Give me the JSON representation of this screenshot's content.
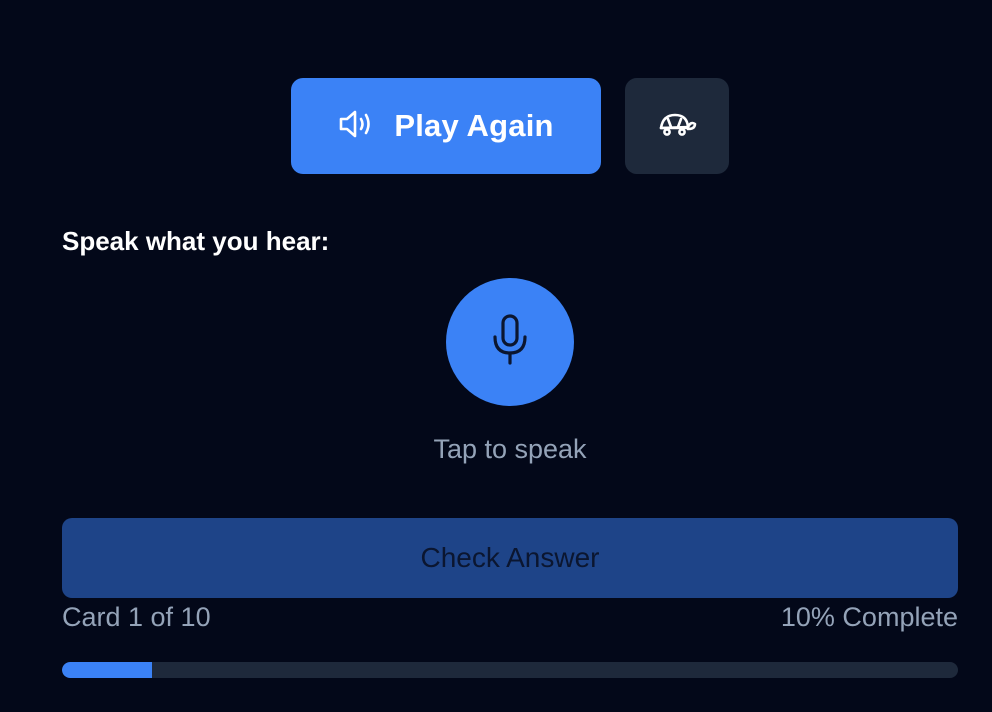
{
  "controls": {
    "play_again_label": "Play Again",
    "play_icon": "speaker-icon",
    "slow_icon": "turtle-icon"
  },
  "prompt": {
    "text": "Speak what you hear:"
  },
  "mic": {
    "icon": "microphone-icon",
    "hint": "Tap to speak"
  },
  "check": {
    "label": "Check Answer"
  },
  "progress": {
    "card_text": "Card 1 of 10",
    "percent_text": "10% Complete",
    "fraction": 0.1
  },
  "colors": {
    "background": "#030819",
    "accent": "#3b82f6",
    "secondary_button": "#1e293b",
    "disabled_button": "#1e4488",
    "muted_text": "#94a3b8"
  }
}
